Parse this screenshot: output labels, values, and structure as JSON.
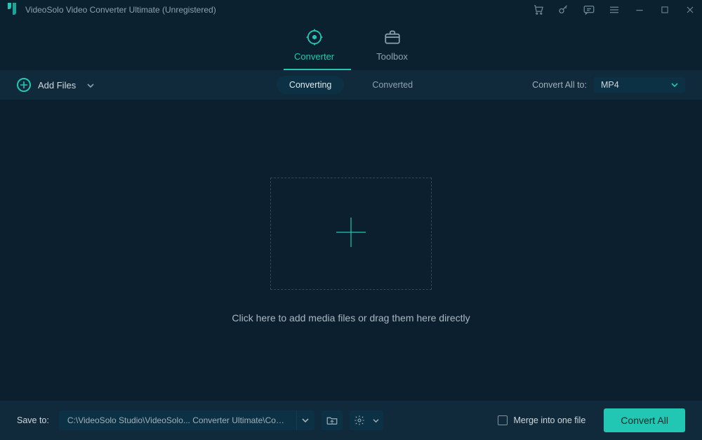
{
  "app": {
    "title": "VideoSolo Video Converter Ultimate (Unregistered)"
  },
  "nav": {
    "converter": "Converter",
    "toolbox": "Toolbox"
  },
  "toolbar": {
    "add_files": "Add Files",
    "seg_converting": "Converting",
    "seg_converted": "Converted",
    "convert_all_to": "Convert All to:",
    "format_selected": "MP4"
  },
  "main": {
    "hint": "Click here to add media files or drag them here directly"
  },
  "bottombar": {
    "save_to": "Save to:",
    "path": "C:\\VideoSolo Studio\\VideoSolo... Converter Ultimate\\Converted",
    "merge": "Merge into one file",
    "convert_all": "Convert All"
  }
}
